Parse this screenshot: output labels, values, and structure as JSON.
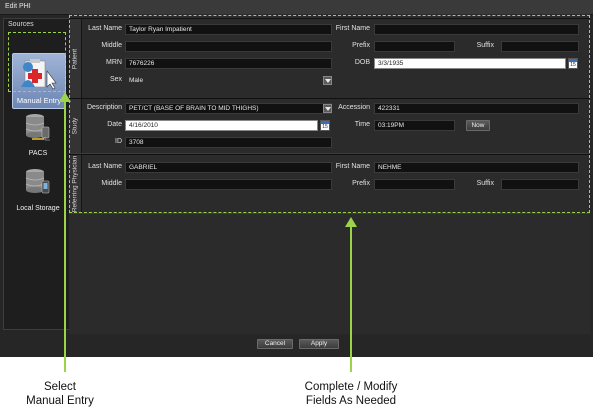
{
  "window": {
    "title": "Edit PHI"
  },
  "sources": {
    "header": "Sources",
    "items": [
      {
        "label": "Manual Entry",
        "icon": "manual-entry-icon"
      },
      {
        "label": "PACS",
        "icon": "pacs-database-icon"
      },
      {
        "label": "Local Storage",
        "icon": "local-storage-icon"
      }
    ]
  },
  "patient": {
    "section_label": "Patient",
    "last_name_label": "Last Name",
    "last_name": "Taylor Ryan Impatient",
    "first_name_label": "First Name",
    "first_name": "",
    "middle_label": "Middle",
    "middle": "",
    "prefix_label": "Prefix",
    "prefix": "",
    "suffix_label": "Suffix",
    "suffix": "",
    "mrn_label": "MRN",
    "mrn": "7676226",
    "dob_label": "DOB",
    "dob": "3/3/1935",
    "sex_label": "Sex",
    "sex": "Male"
  },
  "study": {
    "section_label": "Study",
    "description_label": "Description",
    "description": "PET/CT (BASE OF BRAIN TO MID THIGHS)",
    "accession_label": "Accession",
    "accession": "422331",
    "date_label": "Date",
    "date": "4/16/2010",
    "time_label": "Time",
    "time": "03:19PM",
    "now_button": "Now",
    "id_label": "ID",
    "id": "3708"
  },
  "referring": {
    "section_label": "Referring Physician",
    "last_name_label": "Last Name",
    "last_name": "GABRIEL",
    "first_name_label": "First Name",
    "first_name": "NEHME",
    "middle_label": "Middle",
    "middle": "",
    "prefix_label": "Prefix",
    "prefix": "",
    "suffix_label": "Suffix",
    "suffix": ""
  },
  "calendar_icon_text": "15",
  "buttons": {
    "cancel": "Cancel",
    "apply": "Apply"
  },
  "annotations": {
    "left_line1": "Select",
    "left_line2": "Manual Entry",
    "right_line1": "Complete / Modify",
    "right_line2": "Fields As Needed"
  },
  "colors": {
    "highlight": "#9bd34a",
    "window_bg": "#262626",
    "field_bg": "#111111"
  }
}
